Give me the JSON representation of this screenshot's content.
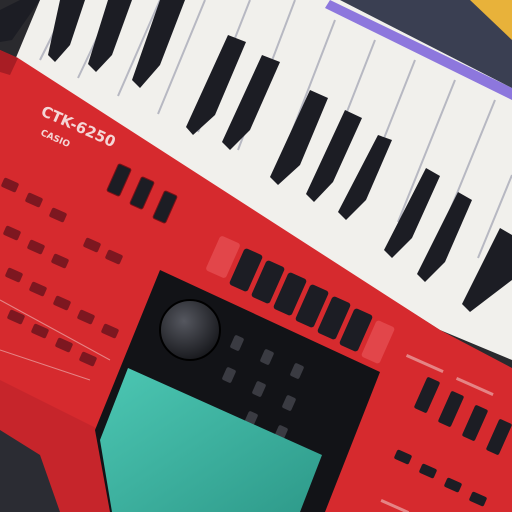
{
  "photo": {
    "subject": "keyboard-synthesizer",
    "colors": {
      "body_red": "#d62a2e",
      "body_red_dark": "#a81d24",
      "white_key": "#f1f0ec",
      "key_shadow": "#cfcfd6",
      "black_key": "#1c1d24",
      "lcd_teal": "#3fb8a4",
      "panel_black": "#121317",
      "yellow_object": "#e8b23a",
      "purple_edge": "#6b4fd8"
    }
  },
  "keyboard": {
    "model_label": "CTK-6250",
    "brand_sub_label": "CASIO"
  }
}
